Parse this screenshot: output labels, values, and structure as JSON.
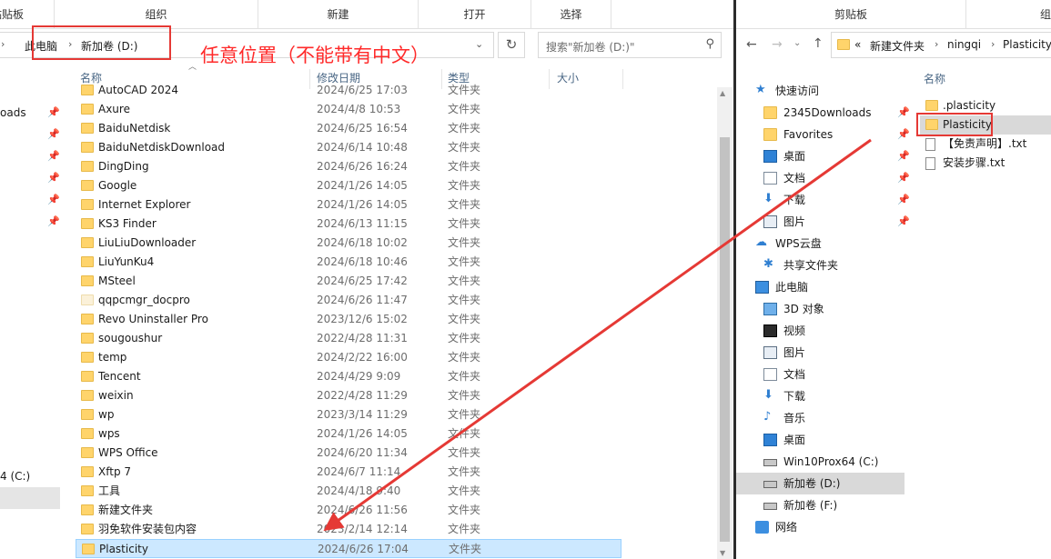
{
  "left_window": {
    "ribbon": [
      "贴贴板",
      "组织",
      "新建",
      "打开",
      "选择"
    ],
    "breadcrumb": [
      "此电脑",
      "新加卷 (D:)"
    ],
    "search_placeholder": "搜索\"新加卷 (D:)\"",
    "columns": {
      "name": "名称",
      "date": "修改日期",
      "type": "类型",
      "size": "大小"
    },
    "nav_items": [
      {
        "label": "oads"
      },
      {
        "label": ""
      },
      {
        "label": ""
      },
      {
        "label": ""
      },
      {
        "label": ""
      },
      {
        "label": ""
      },
      {
        "label": "4 (C:)"
      }
    ],
    "files": [
      {
        "name": "AutoCAD 2024",
        "date": "2024/6/25 17:03",
        "type": "文件夹",
        "light": false
      },
      {
        "name": "Axure",
        "date": "2024/4/8 10:53",
        "type": "文件夹",
        "light": false
      },
      {
        "name": "BaiduNetdisk",
        "date": "2024/6/25 16:54",
        "type": "文件夹",
        "light": false
      },
      {
        "name": "BaiduNetdiskDownload",
        "date": "2024/6/14 10:48",
        "type": "文件夹",
        "light": false
      },
      {
        "name": "DingDing",
        "date": "2024/6/26 16:24",
        "type": "文件夹",
        "light": false
      },
      {
        "name": "Google",
        "date": "2024/1/26 14:05",
        "type": "文件夹",
        "light": false
      },
      {
        "name": "Internet Explorer",
        "date": "2024/1/26 14:05",
        "type": "文件夹",
        "light": false
      },
      {
        "name": "KS3 Finder",
        "date": "2024/6/13 11:15",
        "type": "文件夹",
        "light": false
      },
      {
        "name": "LiuLiuDownloader",
        "date": "2024/6/18 10:02",
        "type": "文件夹",
        "light": false
      },
      {
        "name": "LiuYunKu4",
        "date": "2024/6/18 10:46",
        "type": "文件夹",
        "light": false
      },
      {
        "name": "MSteel",
        "date": "2024/6/25 17:42",
        "type": "文件夹",
        "light": false
      },
      {
        "name": "qqpcmgr_docpro",
        "date": "2024/6/26 11:47",
        "type": "文件夹",
        "light": true
      },
      {
        "name": "Revo Uninstaller Pro",
        "date": "2023/12/6 15:02",
        "type": "文件夹",
        "light": false
      },
      {
        "name": "sougoushur",
        "date": "2022/4/28 11:31",
        "type": "文件夹",
        "light": false
      },
      {
        "name": "temp",
        "date": "2024/2/22 16:00",
        "type": "文件夹",
        "light": false
      },
      {
        "name": "Tencent",
        "date": "2024/4/29 9:09",
        "type": "文件夹",
        "light": false
      },
      {
        "name": "weixin",
        "date": "2022/4/28 11:29",
        "type": "文件夹",
        "light": false
      },
      {
        "name": "wp",
        "date": "2023/3/14 11:29",
        "type": "文件夹",
        "light": false
      },
      {
        "name": "wps",
        "date": "2024/1/26 14:05",
        "type": "文件夹",
        "light": false
      },
      {
        "name": "WPS Office",
        "date": "2024/6/20 11:34",
        "type": "文件夹",
        "light": false
      },
      {
        "name": "Xftp 7",
        "date": "2024/6/7 11:14",
        "type": "文件夹",
        "light": false
      },
      {
        "name": "工具",
        "date": "2024/4/18 9:40",
        "type": "文件夹",
        "light": false
      },
      {
        "name": "新建文件夹",
        "date": "2024/6/26 11:56",
        "type": "文件夹",
        "light": false
      },
      {
        "name": "羽免软件安装包内容",
        "date": "2023/2/14 12:14",
        "type": "文件夹",
        "light": false
      },
      {
        "name": "Plasticity",
        "date": "2024/6/26 17:04",
        "type": "文件夹",
        "light": false,
        "selected": true
      }
    ]
  },
  "right_window": {
    "ribbon": [
      "剪贴板",
      "组"
    ],
    "breadcrumb": [
      "«",
      "新建文件夹",
      "ningqi",
      "Plasticity"
    ],
    "column_name": "名称",
    "nav_items": [
      {
        "label": "快速访问",
        "icon": "star-icon",
        "indent": false,
        "pin": false
      },
      {
        "label": "2345Downloads",
        "icon": "folder-icon",
        "indent": true,
        "pin": true
      },
      {
        "label": "Favorites",
        "icon": "folder-icon",
        "indent": true,
        "pin": true
      },
      {
        "label": "桌面",
        "icon": "desktop-icon",
        "indent": true,
        "pin": true
      },
      {
        "label": "文档",
        "icon": "document-icon",
        "indent": true,
        "pin": true
      },
      {
        "label": "下载",
        "icon": "download-icon",
        "indent": true,
        "pin": true
      },
      {
        "label": "图片",
        "icon": "picture-icon",
        "indent": true,
        "pin": true
      },
      {
        "label": "WPS云盘",
        "icon": "cloud-icon",
        "indent": false,
        "pin": false
      },
      {
        "label": "共享文件夹",
        "icon": "shared-folder-icon",
        "indent": true,
        "pin": false
      },
      {
        "label": "此电脑",
        "icon": "computer-icon",
        "indent": false,
        "pin": false
      },
      {
        "label": "3D 对象",
        "icon": "3d-objects-icon",
        "indent": true,
        "pin": false
      },
      {
        "label": "视频",
        "icon": "video-icon",
        "indent": true,
        "pin": false
      },
      {
        "label": "图片",
        "icon": "picture-icon",
        "indent": true,
        "pin": false
      },
      {
        "label": "文档",
        "icon": "document-icon",
        "indent": true,
        "pin": false
      },
      {
        "label": "下载",
        "icon": "download-icon",
        "indent": true,
        "pin": false
      },
      {
        "label": "音乐",
        "icon": "music-icon",
        "indent": true,
        "pin": false
      },
      {
        "label": "桌面",
        "icon": "desktop-icon",
        "indent": true,
        "pin": false
      },
      {
        "label": "Win10Prox64 (C:)",
        "icon": "drive-icon",
        "indent": true,
        "pin": false
      },
      {
        "label": "新加卷 (D:)",
        "icon": "drive-icon",
        "indent": true,
        "pin": false,
        "selected": true
      },
      {
        "label": "新加卷 (F:)",
        "icon": "drive-icon",
        "indent": true,
        "pin": false
      },
      {
        "label": "网络",
        "icon": "network-icon",
        "indent": false,
        "pin": false
      }
    ],
    "files": [
      {
        "name": ".plasticity",
        "kind": "folder"
      },
      {
        "name": "Plasticity",
        "kind": "folder",
        "selected": true
      },
      {
        "name": "【免责声明】.txt",
        "kind": "txt"
      },
      {
        "name": "安装步骤.txt",
        "kind": "txt"
      }
    ]
  },
  "annotation": {
    "text": "任意位置（不能带有中文）",
    "color": "#ff2a2a"
  }
}
